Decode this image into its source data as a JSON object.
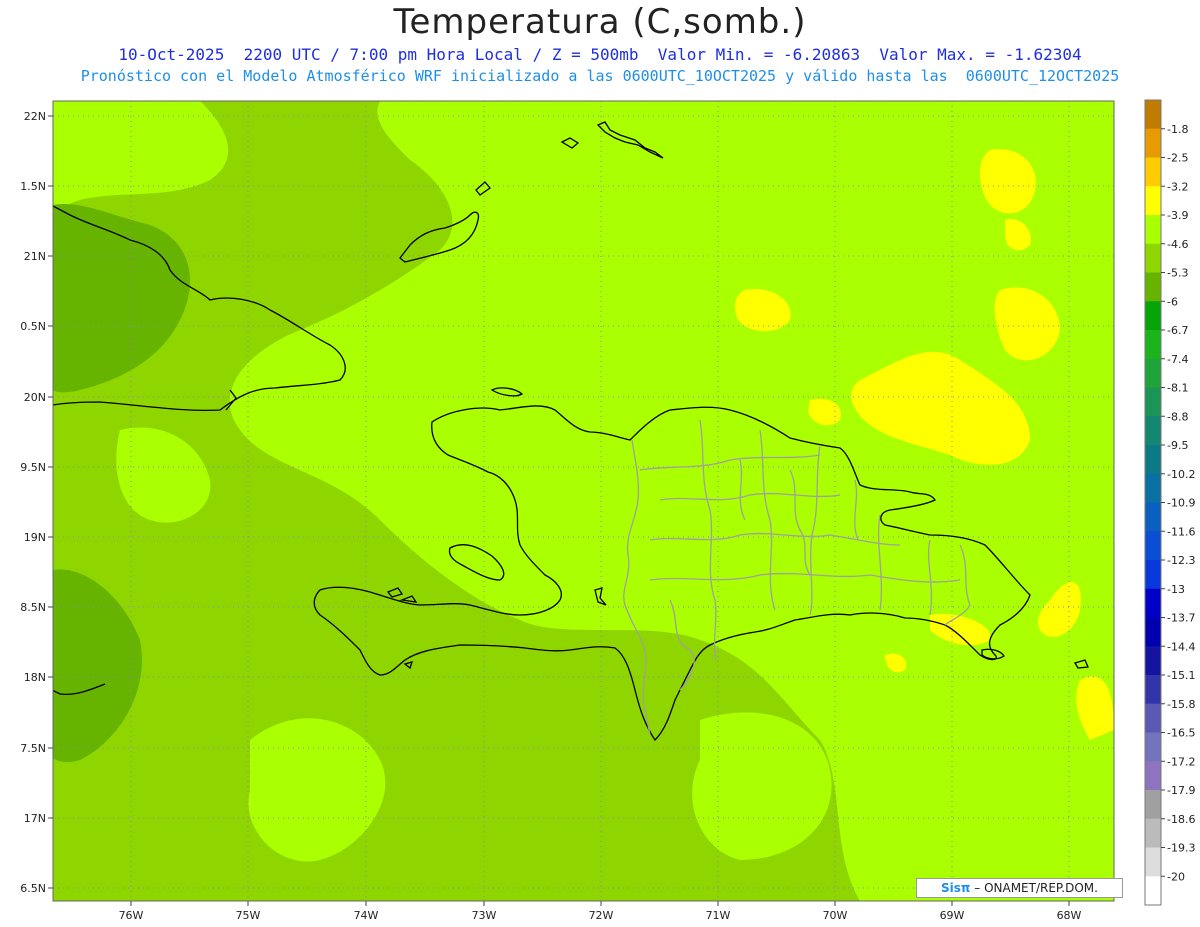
{
  "header": {
    "title": "Temperatura (C,somb.)",
    "info_line": "10-Oct-2025  2200 UTC / 7:00 pm Hora Local / Z = 500mb  Valor Min. = -6.20863  Valor Max. = -1.62304",
    "model_line": "Pronóstico con el Modelo Atmosférico WRF inicializado a las 0600UTC_10OCT2025 y válido hasta las  0600UTC_12OCT2025"
  },
  "axes": {
    "lon_labels": [
      "76W",
      "75W",
      "74W",
      "73W",
      "72W",
      "71W",
      "70W",
      "69W",
      "68W"
    ],
    "lat_labels": [
      "22N",
      "1.5N",
      "21N",
      "0.5N",
      "20N",
      "9.5N",
      "19N",
      "8.5N",
      "18N",
      "7.5N",
      "17N",
      "6.5N"
    ]
  },
  "colorbar": {
    "labels": [
      "-1.8",
      "-2.5",
      "-3.2",
      "-3.9",
      "-4.6",
      "-5.3",
      "-6",
      "-6.7",
      "-7.4",
      "-8.1",
      "-8.8",
      "-9.5",
      "-10.2",
      "-10.9",
      "-11.6",
      "-12.3",
      "-13",
      "-13.7",
      "-14.4",
      "-15.1",
      "-15.8",
      "-16.5",
      "-17.2",
      "-17.9",
      "-18.6",
      "-19.3",
      "-20"
    ],
    "colors": [
      "#c07c00",
      "#e79b00",
      "#ffcc00",
      "#ffff00",
      "#aaff00",
      "#8fd600",
      "#66b400",
      "#06a406",
      "#1cb41c",
      "#1fa43a",
      "#1b9557",
      "#13876f",
      "#0c7a86",
      "#0970a2",
      "#0a5fc0",
      "#0b4ed6",
      "#0838dc",
      "#0000c8",
      "#0000b0",
      "#1414a0",
      "#3434aa",
      "#5a5ab4",
      "#7474be",
      "#8e74c0",
      "#a0a0a0",
      "#bbbbbb",
      "#dddddd",
      "#ffffff"
    ]
  },
  "map": {
    "field_colors": {
      "base": "#8fd600",
      "light": "#aaff00",
      "warm": "#ffff00",
      "warmer": "#ffcc00",
      "cool": "#66b400"
    }
  },
  "credit": {
    "brand": "Sisπ",
    "text": "– ONAMET/REP.DOM."
  }
}
